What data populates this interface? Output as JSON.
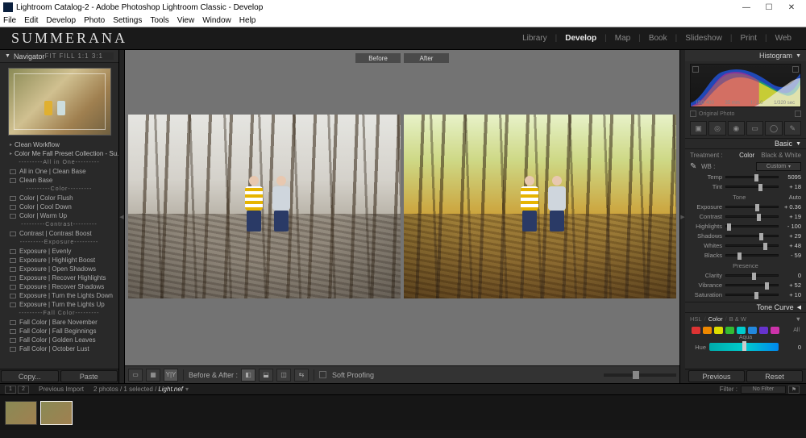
{
  "window": {
    "title": "Lightroom Catalog-2 - Adobe Photoshop Lightroom Classic - Develop",
    "min": "—",
    "max": "☐",
    "close": "✕"
  },
  "menu": [
    "File",
    "Edit",
    "Develop",
    "Photo",
    "Settings",
    "Tools",
    "View",
    "Window",
    "Help"
  ],
  "brand": "SUMMERANA",
  "modules": {
    "items": [
      "Library",
      "Develop",
      "Map",
      "Book",
      "Slideshow",
      "Print",
      "Web"
    ],
    "active_index": 1
  },
  "navigator": {
    "title": "Navigator",
    "modes": "FIT   FILL   1:1   3:1"
  },
  "presets": {
    "items": [
      {
        "type": "folder",
        "label": "Clean Workflow"
      },
      {
        "type": "folder",
        "label": "Color Me Fall Preset Collection - Su..."
      },
      {
        "type": "divider",
        "label": "---------All in One---------"
      },
      {
        "type": "preset",
        "label": "All in One | Clean Base"
      },
      {
        "type": "preset",
        "label": "Clean Base"
      },
      {
        "type": "divider",
        "label": "---------Color---------"
      },
      {
        "type": "preset",
        "label": "Color | Color Flush"
      },
      {
        "type": "preset",
        "label": "Color | Cool Down"
      },
      {
        "type": "preset",
        "label": "Color | Warm Up"
      },
      {
        "type": "divider",
        "label": "---------Contrast---------"
      },
      {
        "type": "preset",
        "label": "Contrast | Contrast Boost"
      },
      {
        "type": "divider",
        "label": "---------Exposure---------"
      },
      {
        "type": "preset",
        "label": "Exposure | Evenly"
      },
      {
        "type": "preset",
        "label": "Exposure | Highlight Boost"
      },
      {
        "type": "preset",
        "label": "Exposure | Open Shadows"
      },
      {
        "type": "preset",
        "label": "Exposure | Recover Highlights"
      },
      {
        "type": "preset",
        "label": "Exposure | Recover Shadows"
      },
      {
        "type": "preset",
        "label": "Exposure | Turn the Lights Down"
      },
      {
        "type": "preset",
        "label": "Exposure | Turn the Lights Up"
      },
      {
        "type": "divider",
        "label": "---------Fall Color---------"
      },
      {
        "type": "preset",
        "label": "Fall Color | Bare November"
      },
      {
        "type": "preset",
        "label": "Fall Color | Fall Beginnings"
      },
      {
        "type": "preset",
        "label": "Fall Color | Golden Leaves"
      },
      {
        "type": "preset",
        "label": "Fall Color | October Lust"
      }
    ]
  },
  "leftButtons": {
    "copy": "Copy...",
    "paste": "Paste"
  },
  "compare": {
    "before": "Before",
    "after": "After"
  },
  "centerToolbar": {
    "beforeAfterLabel": "Before & After :",
    "softProofing": "Soft Proofing"
  },
  "histogram": {
    "title": "Histogram",
    "meta": [
      "ISO 400",
      "35 mm",
      "f / 2.0",
      "1/320 sec"
    ],
    "originalPhoto": "Original Photo"
  },
  "basic": {
    "title": "Basic",
    "treatment": "Treatment :",
    "color": "Color",
    "bw": "Black & White",
    "wbLabel": "WB :",
    "wbValue": "Custom",
    "temp": {
      "label": "Temp",
      "value": "5095",
      "pos": 55
    },
    "tint": {
      "label": "Tint",
      "value": "+ 18",
      "pos": 62
    },
    "toneHdr": "Tone",
    "auto": "Auto",
    "exposure": {
      "label": "Exposure",
      "value": "+ 0.36",
      "pos": 56
    },
    "contrast": {
      "label": "Contrast",
      "value": "+ 19",
      "pos": 60
    },
    "highlights": {
      "label": "Highlights",
      "value": "- 100",
      "pos": 2
    },
    "shadows": {
      "label": "Shadows",
      "value": "+ 29",
      "pos": 64
    },
    "whites": {
      "label": "Whites",
      "value": "+ 48",
      "pos": 72
    },
    "blacks": {
      "label": "Blacks",
      "value": "- 59",
      "pos": 22
    },
    "presenceHdr": "Presence",
    "clarity": {
      "label": "Clarity",
      "value": "0",
      "pos": 50
    },
    "vibrance": {
      "label": "Vibrance",
      "value": "+ 52",
      "pos": 75
    },
    "saturation": {
      "label": "Saturation",
      "value": "+ 10",
      "pos": 55
    }
  },
  "toneCurve": {
    "title": "Tone Curve"
  },
  "hsl": {
    "tabs": [
      "HSL",
      "Color",
      "B & W"
    ],
    "active": 1,
    "aqua": "Aqua",
    "hueLabel": "Hue",
    "all": "All",
    "colors": [
      "#d33",
      "#e80",
      "#dd0",
      "#3b3",
      "#0cc",
      "#28d",
      "#63c",
      "#c3a"
    ]
  },
  "rightButtons": {
    "previous": "Previous",
    "reset": "Reset"
  },
  "secondary": {
    "viewNums": [
      "1",
      "2"
    ],
    "prevImport": "Previous Import",
    "count": "2 photos / 1 selected /",
    "filename": "Light.nef",
    "filterLabel": "Filter :",
    "filterValue": "No Filter"
  }
}
